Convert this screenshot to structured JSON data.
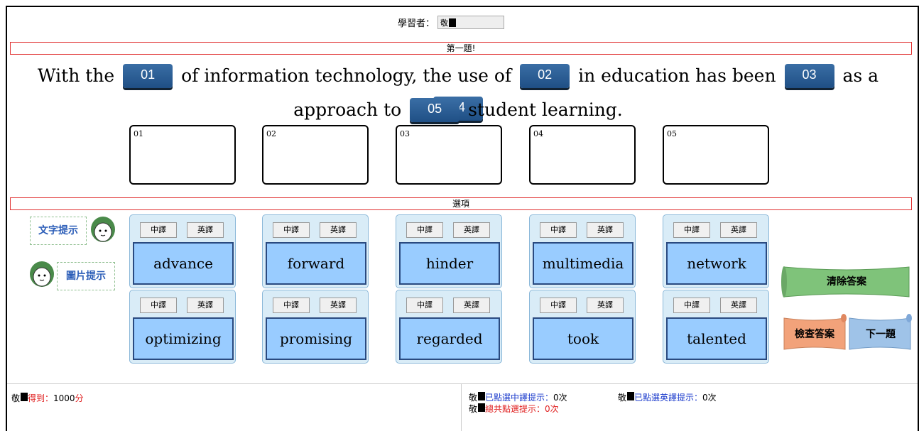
{
  "header": {
    "learner_label": "學習者：",
    "learner_value": "敬"
  },
  "question": {
    "title": "第一題!",
    "text": [
      "With the",
      "of information technology, the use of",
      "in education has been",
      "as a",
      "approach to",
      "student learning."
    ],
    "blanks": [
      "01",
      "02",
      "03",
      "04",
      "05"
    ]
  },
  "answer_boxes": [
    "01",
    "02",
    "03",
    "04",
    "05"
  ],
  "options_title": "選項",
  "hints": {
    "text_hint": "文字提示",
    "image_hint": "圖片提示"
  },
  "options": [
    {
      "zh": "中譯",
      "en": "英譯",
      "word": "advance"
    },
    {
      "zh": "中譯",
      "en": "英譯",
      "word": "forward"
    },
    {
      "zh": "中譯",
      "en": "英譯",
      "word": "hinder"
    },
    {
      "zh": "中譯",
      "en": "英譯",
      "word": "multimedia"
    },
    {
      "zh": "中譯",
      "en": "英譯",
      "word": "network"
    },
    {
      "zh": "中譯",
      "en": "英譯",
      "word": "optimizing"
    },
    {
      "zh": "中譯",
      "en": "英譯",
      "word": "promising"
    },
    {
      "zh": "中譯",
      "en": "英譯",
      "word": "regarded"
    },
    {
      "zh": "中譯",
      "en": "英譯",
      "word": "took"
    },
    {
      "zh": "中譯",
      "en": "英譯",
      "word": "talented"
    }
  ],
  "actions": {
    "clear": "清除答案",
    "check": "檢查答案",
    "next": "下一題"
  },
  "footer": {
    "name": "敬",
    "score_label": "得到：",
    "score_value": "1000",
    "score_unit": "分",
    "zh_hint_label": "已點選中譯提示：",
    "zh_hint_value": "0次",
    "en_hint_label": "已點選英譯提示：",
    "en_hint_value": "0次",
    "total_hint_label": "總共點選提示：",
    "total_hint_value": "0次"
  },
  "colors": {
    "blank": "#2b5f98",
    "card_bg": "#d9ecf7",
    "word_bg": "#99ccff",
    "bar_border": "#e03030",
    "clear_scroll": "#7fc37a",
    "check_scroll": "#f2a27a",
    "next_scroll": "#9fc3e8"
  }
}
